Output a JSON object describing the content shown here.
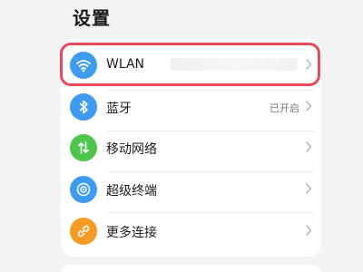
{
  "header": {
    "title": "设置"
  },
  "rows": [
    {
      "label": "WLAN",
      "value": "",
      "icon": "wifi-icon",
      "color": "#3f9bf0"
    },
    {
      "label": "蓝牙",
      "value": "已开启",
      "icon": "bluetooth-icon",
      "color": "#3f9bf0"
    },
    {
      "label": "移动网络",
      "value": "",
      "icon": "mobile-network-icon",
      "color": "#4cc64b"
    },
    {
      "label": "超级终端",
      "value": "",
      "icon": "super-device-icon",
      "color": "#3f9bf0"
    },
    {
      "label": "更多连接",
      "value": "",
      "icon": "link-icon",
      "color": "#f59a23"
    }
  ],
  "highlight_color": "#e84a57"
}
